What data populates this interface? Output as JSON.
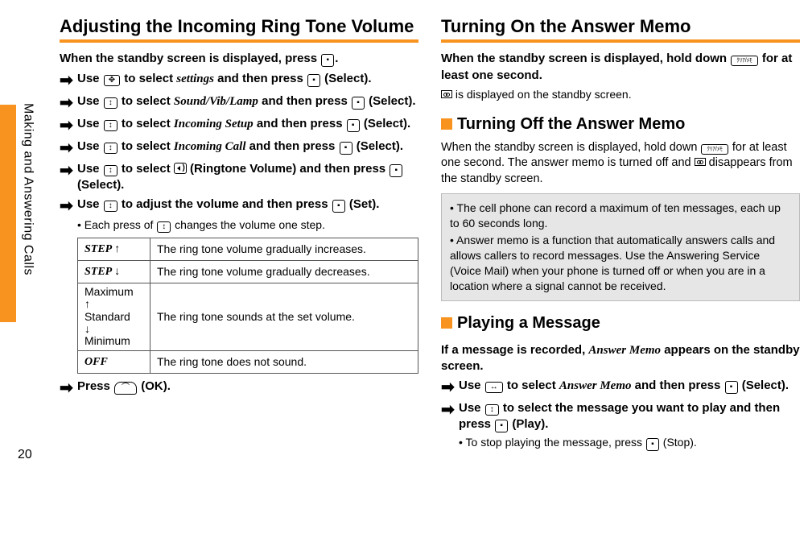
{
  "page_number": "20",
  "side_label": "Making and Answering Calls",
  "left": {
    "title": "Adjusting the Incoming Ring Tone Volume",
    "intro_a": "When the standby screen is displayed, press ",
    "intro_b": ".",
    "steps": [
      {
        "pre": "Use ",
        "mid_plain": " to select ",
        "mid_ital": "settings",
        "post": " and then press ",
        "tail": " (Select).",
        "key1": "✥",
        "key2": "▪"
      },
      {
        "pre": "Use ",
        "mid_plain": " to select ",
        "mid_ital": "Sound/Vib/Lamp",
        "post": " and then press ",
        "tail": " (Select).",
        "key1": "↕",
        "key2": "▪"
      },
      {
        "pre": "Use ",
        "mid_plain": " to select ",
        "mid_ital": "Incoming Setup",
        "post": " and then press ",
        "tail": " (Select).",
        "key1": "↕",
        "key2": "▪"
      },
      {
        "pre": "Use ",
        "mid_plain": " to select ",
        "mid_ital": "Incoming Call",
        "post": " and then press ",
        "tail": " (Select).",
        "key1": "↕",
        "key2": "▪"
      },
      {
        "pre": "Use ",
        "mid_plain": " to select ",
        "mid_ringtone": " (Ringtone Volume) and then press ",
        "tail": " (Select).",
        "key1": "↕",
        "key2": "▪"
      },
      {
        "pre": "Use ",
        "mid_plain": " to adjust the volume and then press ",
        "tail": " (Set).",
        "key1": "↕",
        "key2": "▪"
      }
    ],
    "sub_note": "Each press of  changes the volume one step.",
    "sub_note_a": "Each press of ",
    "sub_note_b": " changes the volume one step.",
    "table": {
      "rows": [
        {
          "label": "STEP ↑",
          "label_italic": true,
          "desc": "The ring tone volume gradually increases."
        },
        {
          "label": "STEP ↓",
          "label_italic": true,
          "desc": "The ring tone volume gradually decreases."
        },
        {
          "label_multi": "Maximum\n↑\nStandard\n↓\nMinimum",
          "desc": "The ring tone sounds at the set volume."
        },
        {
          "label": "OFF",
          "label_italic": true,
          "desc": "The ring tone does not sound."
        }
      ]
    },
    "final_step_a": "Press ",
    "final_step_b": " (OK)."
  },
  "right": {
    "title": "Turning On the Answer Memo",
    "intro_a": "When the standby screen is displayed, hold down ",
    "intro_b": " for at least one second.",
    "intro_sub_a": "",
    "intro_sub_b": " is displayed on the standby screen.",
    "sub1_title": "Turning Off the Answer Memo",
    "sub1_body_a": "When the standby screen is displayed, hold down ",
    "sub1_body_b": " for at least one second. The answer memo is turned off and ",
    "sub1_body_c": " disappears from the standby screen.",
    "notes": [
      "The cell phone can record a maximum of ten messages, each up to 60 seconds long.",
      "Answer memo is a function that automatically answers calls and allows callers to record messages. Use the Answering Service (Voice Mail) when your phone is turned off or when you are in a location where a signal cannot be received."
    ],
    "sub2_title": "Playing a Message",
    "sub2_intro_a": "If a message is recorded, ",
    "sub2_intro_ital": "Answer Memo",
    "sub2_intro_b": " appears on the standby screen.",
    "sub2_steps": [
      {
        "pre": "Use ",
        "mid_plain": " to select ",
        "mid_ital": "Answer Memo",
        "post": " and then press ",
        "tail": " (Select).",
        "key1": "↔",
        "key2": "▪"
      },
      {
        "pre": "Use ",
        "mid_plain": " to select the message you want to play and then press ",
        "tail": " (Play).",
        "key1": "↕",
        "key2": "▪"
      }
    ],
    "sub2_sub_a": "To stop playing the message, press ",
    "sub2_sub_b": " (Stop)."
  }
}
